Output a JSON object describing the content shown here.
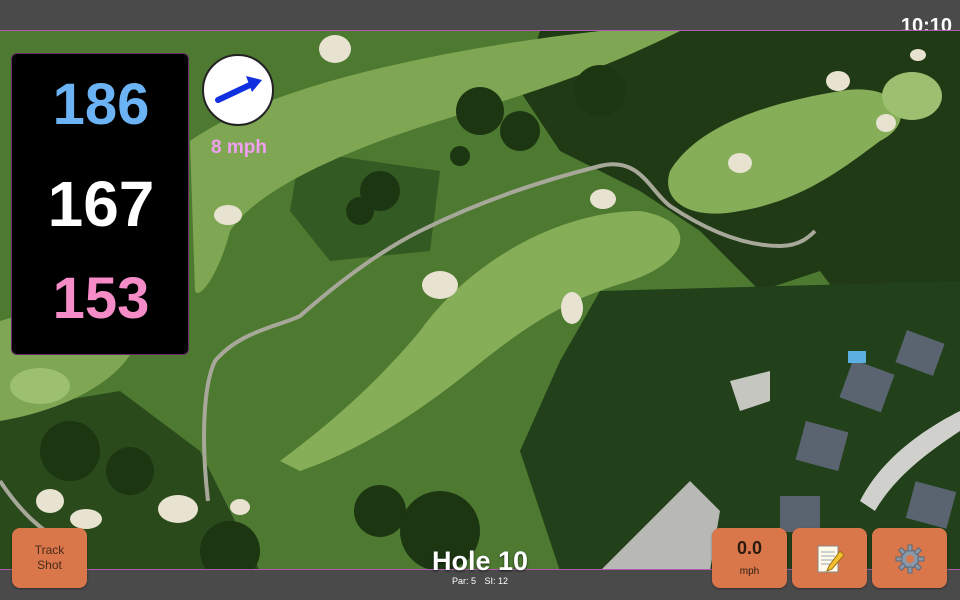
{
  "status_bar": {
    "time": "10:10"
  },
  "distances": {
    "back": "186",
    "middle": "167",
    "front": "153",
    "colors": {
      "back": "#6bb3f5",
      "middle": "#ffffff",
      "front": "#f58cc8"
    }
  },
  "wind": {
    "speed_label": "8 mph",
    "arrow_color": "#1030e0",
    "label_color": "#f0a0f0"
  },
  "buttons": {
    "track_shot": {
      "line1": "Track",
      "line2": "Shot"
    },
    "wind_speed": {
      "value": "0.0",
      "unit": "mph"
    },
    "notes": {
      "icon": "notepad-pencil-icon"
    },
    "settings": {
      "icon": "gear-icon"
    }
  },
  "hole": {
    "title": "Hole 10",
    "par": "Par: 5",
    "si": "SI: 12"
  },
  "colors": {
    "button": "#d9774a",
    "bar": "#4a4a4a"
  }
}
